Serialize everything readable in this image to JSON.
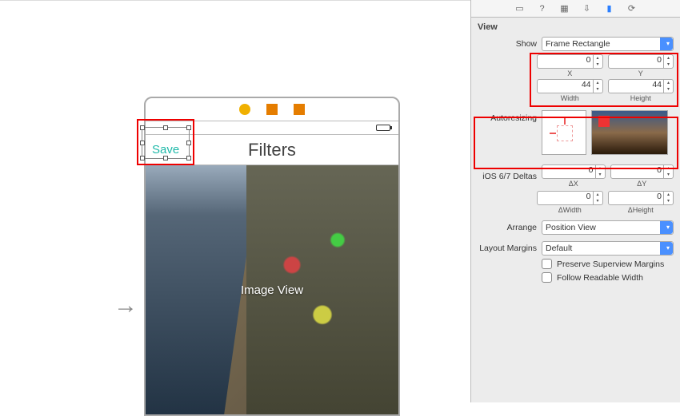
{
  "canvas": {
    "save_label": "Save",
    "nav_title": "Filters",
    "image_label": "Image View"
  },
  "inspector": {
    "section": "View",
    "show_label": "Show",
    "show_value": "Frame Rectangle",
    "frame": {
      "x": "0",
      "x_label": "X",
      "y": "0",
      "y_label": "Y",
      "w": "44",
      "w_label": "Width",
      "h": "44",
      "h_label": "Height"
    },
    "autoresizing_label": "Autoresizing",
    "deltas_label": "iOS 6/7 Deltas",
    "deltas": {
      "dx": "0",
      "dx_label": "ΔX",
      "dy": "0",
      "dy_label": "ΔY",
      "dw": "0",
      "dw_label": "ΔWidth",
      "dh": "0",
      "dh_label": "ΔHeight"
    },
    "arrange_label": "Arrange",
    "arrange_value": "Position View",
    "margins_label": "Layout Margins",
    "margins_value": "Default",
    "preserve_label": "Preserve Superview Margins",
    "follow_label": "Follow Readable Width"
  }
}
